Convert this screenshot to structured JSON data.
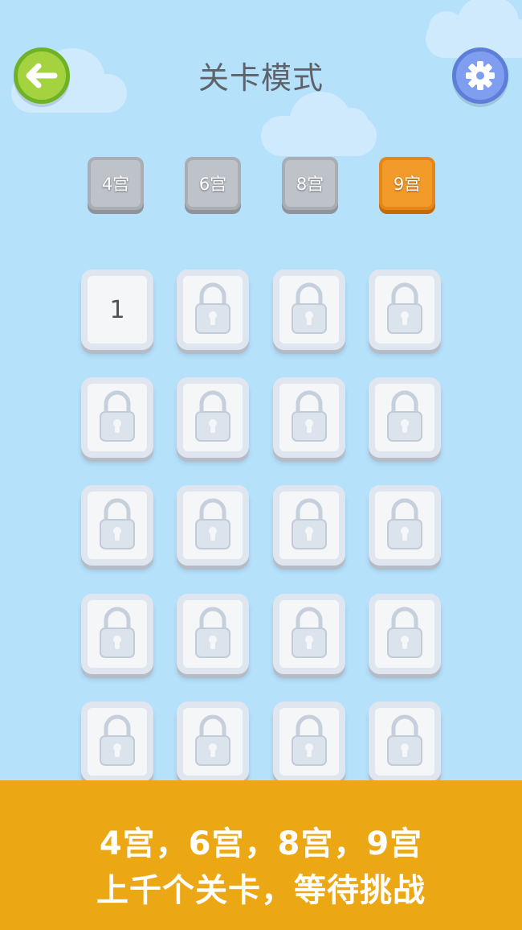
{
  "header": {
    "title": "关卡模式",
    "back_icon": "arrow-left-icon",
    "settings_icon": "gear-icon"
  },
  "tabs": [
    {
      "label": "4宫",
      "active": false
    },
    {
      "label": "6宫",
      "active": false
    },
    {
      "label": "8宫",
      "active": false
    },
    {
      "label": "9宫",
      "active": true
    }
  ],
  "levels": {
    "unlocked": [
      {
        "label": "1"
      }
    ],
    "locked_icon": "lock-icon",
    "visible_total": 20
  },
  "banner": {
    "line1": "4宫，6宫，8宫，9宫",
    "line2": "上千个关卡，等待挑战"
  },
  "colors": {
    "sky": "#b6e1fb",
    "active_tab": "#f39b2a",
    "inactive_tab": "#bec3ca",
    "banner": "#eca814",
    "back_button": "#a5d33f",
    "settings_button": "#809ef0"
  }
}
